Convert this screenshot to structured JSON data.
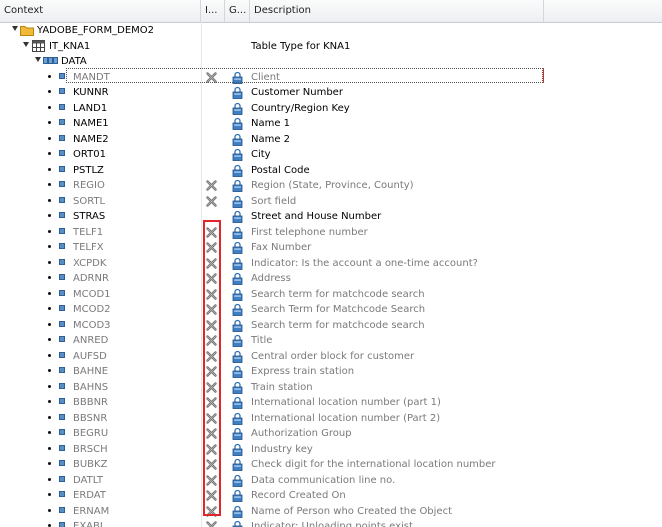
{
  "columns": {
    "context": "Context",
    "col_i": "I...",
    "col_g": "G...",
    "description": "Description"
  },
  "tree": {
    "root": {
      "label": "YADOBE_FORM_DEMO2"
    },
    "table": {
      "label": "IT_KNA1",
      "description": "Table Type for KNA1"
    },
    "structure": {
      "label": "DATA"
    },
    "fields": [
      {
        "name": "MANDT",
        "description": "Client",
        "inactive": true,
        "selected": true
      },
      {
        "name": "KUNNR",
        "description": "Customer Number",
        "inactive": false
      },
      {
        "name": "LAND1",
        "description": "Country/Region Key",
        "inactive": false
      },
      {
        "name": "NAME1",
        "description": "Name 1",
        "inactive": false
      },
      {
        "name": "NAME2",
        "description": "Name 2",
        "inactive": false
      },
      {
        "name": "ORT01",
        "description": "City",
        "inactive": false
      },
      {
        "name": "PSTLZ",
        "description": "Postal Code",
        "inactive": false
      },
      {
        "name": "REGIO",
        "description": "Region (State, Province, County)",
        "inactive": true
      },
      {
        "name": "SORTL",
        "description": "Sort field",
        "inactive": true
      },
      {
        "name": "STRAS",
        "description": "Street and House Number",
        "inactive": false
      },
      {
        "name": "TELF1",
        "description": "First telephone number",
        "inactive": true
      },
      {
        "name": "TELFX",
        "description": "Fax Number",
        "inactive": true
      },
      {
        "name": "XCPDK",
        "description": "Indicator: Is the account a one-time account?",
        "inactive": true
      },
      {
        "name": "ADRNR",
        "description": "Address",
        "inactive": true
      },
      {
        "name": "MCOD1",
        "description": "Search term for matchcode search",
        "inactive": true
      },
      {
        "name": "MCOD2",
        "description": "Search Term for Matchcode Search",
        "inactive": true
      },
      {
        "name": "MCOD3",
        "description": "Search term for matchcode search",
        "inactive": true
      },
      {
        "name": "ANRED",
        "description": "Title",
        "inactive": true
      },
      {
        "name": "AUFSD",
        "description": "Central order block for customer",
        "inactive": true
      },
      {
        "name": "BAHNE",
        "description": "Express train station",
        "inactive": true
      },
      {
        "name": "BAHNS",
        "description": "Train station",
        "inactive": true
      },
      {
        "name": "BBBNR",
        "description": "International location number  (part 1)",
        "inactive": true
      },
      {
        "name": "BBSNR",
        "description": "International location number (Part 2)",
        "inactive": true
      },
      {
        "name": "BEGRU",
        "description": "Authorization Group",
        "inactive": true
      },
      {
        "name": "BRSCH",
        "description": "Industry key",
        "inactive": true
      },
      {
        "name": "BUBKZ",
        "description": "Check digit for the international location number",
        "inactive": true
      },
      {
        "name": "DATLT",
        "description": "Data communication line no.",
        "inactive": true
      },
      {
        "name": "ERDAT",
        "description": "Record Created On",
        "inactive": true
      },
      {
        "name": "ERNAM",
        "description": "Name of Person who Created the Object",
        "inactive": true
      },
      {
        "name": "EXABL",
        "description": "Indicator: Unloading points exist",
        "inactive": true
      }
    ]
  },
  "icons": {
    "folder": "folder-icon",
    "table": "table-icon",
    "structure": "structure-icon",
    "field": "field-icon",
    "inactive": "x-cross-icon",
    "lock": "lock-icon"
  },
  "colors": {
    "highlight": "#e0262b",
    "field_icon": "#5a8fc6",
    "inactive_text": "#7a7a7a",
    "lock": "#2f6fb4",
    "folder": "#f0b93a"
  }
}
